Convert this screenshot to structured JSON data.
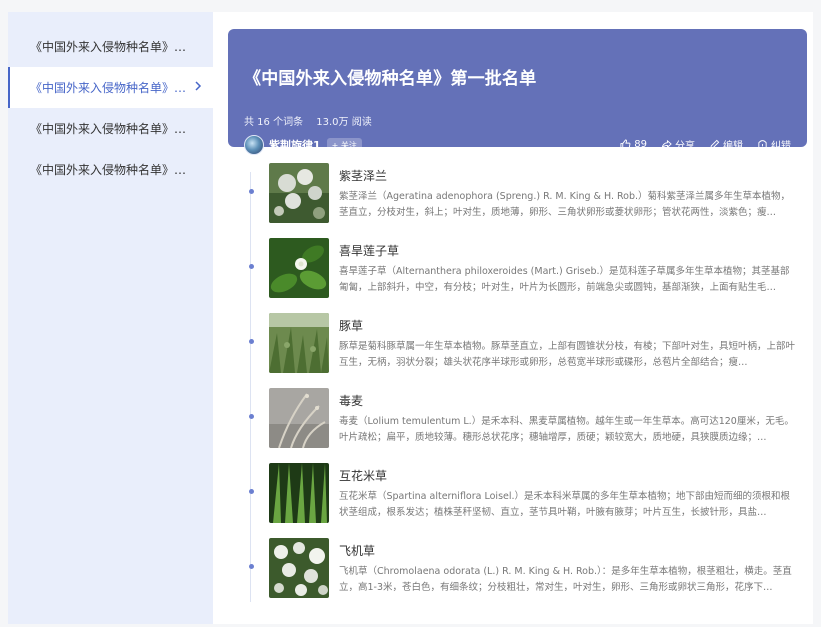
{
  "sidebar": {
    "items": [
      {
        "label": "《中国外来入侵物种名单》第四批名单"
      },
      {
        "label": "《中国外来入侵物种名单》第一批名单"
      },
      {
        "label": "《中国外来入侵物种名单》第二批名单"
      },
      {
        "label": "《中国外来入侵物种名单》第三批名单"
      }
    ]
  },
  "hero": {
    "title": "《中国外来入侵物种名单》第一批名单",
    "count": "共 16 个词条",
    "views": "13.0万 阅读",
    "user": "紫荆旋律1",
    "follow": "+ 关注",
    "likes": "89",
    "share": "分享",
    "edit": "编辑",
    "correct": "纠错"
  },
  "colors": {
    "accent": "#4766c8",
    "hero_bg": "#6471b8",
    "sidebar_bg": "#e9eefb"
  },
  "entries": [
    {
      "title": "紫茎泽兰",
      "desc": "紫茎泽兰（Ageratina adenophora (Spreng.) R. M. King & H. Rob.）菊科紫茎泽兰属多年生草本植物，茎直立，分枝对生，斜上；叶对生，质地薄，卵形、三角状卵形或菱状卵形；管状花两性，淡紫色；瘦…",
      "thumb": "flower-white"
    },
    {
      "title": "喜旱莲子草",
      "desc": "喜旱莲子草（Alternanthera philoxeroides (Mart.) Griseb.）是苋科莲子草属多年生草本植物；其茎基部匍匐，上部斜升，中空，有分枝；叶对生，叶片为长圆形，前端急尖或圆钝，基部渐狭，上面有贴生毛…",
      "thumb": "green-leaf"
    },
    {
      "title": "豚草",
      "desc": "豚草是菊科豚草属一年生草本植物。豚草茎直立，上部有圆锥状分枝，有棱；下部叶对生，具短叶柄，上部叶互生，无柄，羽状分裂；雄头状花序半球形或卵形，总苞宽半球形或碟形，总苞片全部结合；瘦…",
      "thumb": "grass-field"
    },
    {
      "title": "毒麦",
      "desc": "毒麦（Lolium temulentum L.）是禾本科、黑麦草属植物。越年生或一年生草本。高可达120厘米，无毛。叶片疏松；扁平，质地较薄。穗形总状花序；穗轴增厚，质硬；颖较宽大，质地硬，具狭膜质边缘；…",
      "thumb": "grey-grass"
    },
    {
      "title": "互花米草",
      "desc": "互花米草（Spartina alterniflora Loisel.）是禾本科米草属的多年生草本植物；地下部由短而细的须根和根状茎组成，根系发达；植株茎秆坚韧、直立，茎节具叶鞘，叶腋有腋芽；叶片互生，长披针形，具盐…",
      "thumb": "green-blades"
    },
    {
      "title": "飞机草",
      "desc": "飞机草（Chromolaena odorata (L.) R. M. King & H. Rob.）：是多年生草本植物，根茎粗壮，横走。茎直立，高1-3米，苍白色，有细条纹；分枝粗壮，常对生，叶对生，卵形、三角形或卵状三角形，花序下…",
      "thumb": "white-flowers"
    }
  ]
}
